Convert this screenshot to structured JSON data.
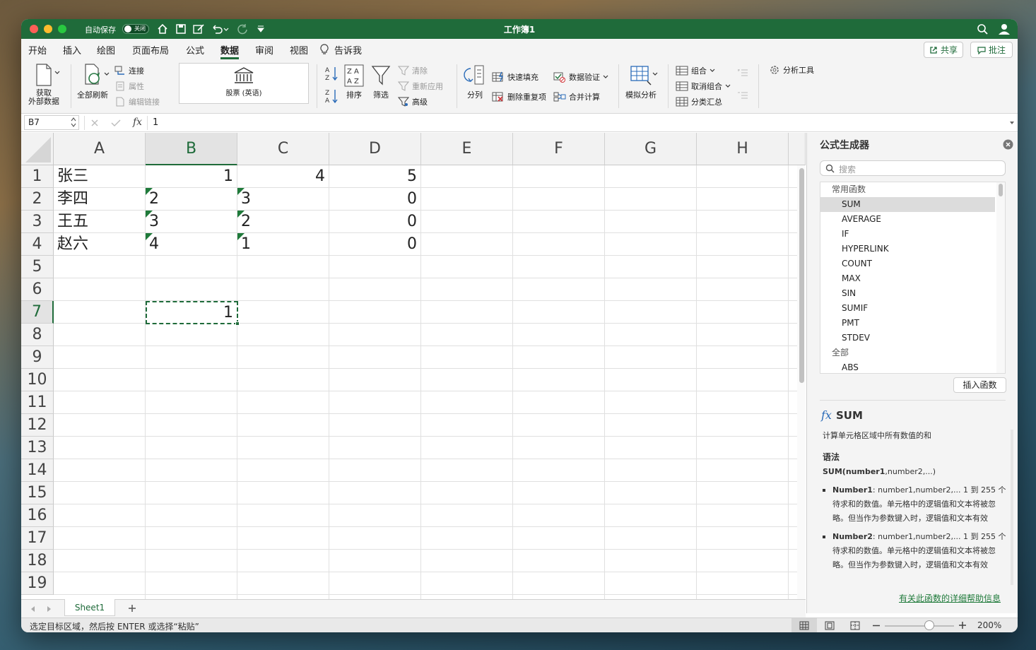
{
  "window": {
    "title": "工作簿1",
    "autosave_label": "自动保存",
    "autosave_state": "关闭"
  },
  "ribbon_tabs": [
    "开始",
    "插入",
    "绘图",
    "页面布局",
    "公式",
    "数据",
    "审阅",
    "视图"
  ],
  "active_tab": "数据",
  "tell_me": "告诉我",
  "share_label": "共享",
  "comments_label": "批注",
  "ribbon": {
    "get_data": [
      "获取",
      "外部数据"
    ],
    "refresh_all": "全部刷新",
    "connections": "连接",
    "properties": "属性",
    "edit_links": "编辑链接",
    "stocks": "股票 (英语)",
    "sort": "排序",
    "filter": "筛选",
    "clear": "清除",
    "reapply": "重新应用",
    "advanced": "高级",
    "text_to_columns": "分列",
    "flash_fill": "快速填充",
    "remove_duplicates": "删除重复项",
    "data_validation": "数据验证",
    "consolidate": "合并计算",
    "what_if": "模拟分析",
    "group": "组合",
    "ungroup": "取消组合",
    "subtotal": "分类汇总",
    "analysis_tools": "分析工具"
  },
  "formula_bar": {
    "name_box": "B7",
    "fx_label": "fx",
    "value": "1"
  },
  "grid": {
    "columns": [
      "A",
      "B",
      "C",
      "D",
      "E",
      "F",
      "G",
      "H"
    ],
    "selected_column": "B",
    "rows": [
      "1",
      "2",
      "3",
      "4",
      "5",
      "6",
      "7",
      "8",
      "9",
      "10",
      "11",
      "12",
      "13",
      "14",
      "15",
      "16",
      "17",
      "18",
      "19"
    ],
    "selected_row": "7",
    "cells": {
      "A1": "张三",
      "B1": "1",
      "C1": "4",
      "D1": "5",
      "A2": "李四",
      "B2": "2",
      "C2": "3",
      "D2": "0",
      "A3": "王五",
      "B3": "3",
      "C3": "2",
      "D3": "0",
      "A4": "赵六",
      "B4": "4",
      "C4": "1",
      "D4": "0",
      "B7": "1"
    }
  },
  "sheet_tabs": [
    "Sheet1"
  ],
  "status": {
    "message": "选定目标区域，然后按 ENTER 或选择“粘贴”",
    "zoom": "200%"
  },
  "panel": {
    "title": "公式生成器",
    "search_placeholder": "搜索",
    "group_common": "常用函数",
    "functions": [
      "SUM",
      "AVERAGE",
      "IF",
      "HYPERLINK",
      "COUNT",
      "MAX",
      "SIN",
      "SUMIF",
      "PMT",
      "STDEV"
    ],
    "group_all": "全部",
    "all_first": "ABS",
    "insert_button": "插入函数",
    "detail_fx": "fx",
    "detail_name": "SUM",
    "detail_desc": "计算单元格区域中所有数值的和",
    "syntax_heading": "语法",
    "syntax_bold": "SUM(number1",
    "syntax_rest": ",number2,...)",
    "arg1_name": "Number1",
    "arg1_text": ": number1,number2,... 1 到 255 个待求和的数值。单元格中的逻辑值和文本将被忽略。但当作为参数键入时，逻辑值和文本有效",
    "arg2_name": "Number2",
    "arg2_text": ": number1,number2,... 1 到 255 个待求和的数值。单元格中的逻辑值和文本将被忽略。但当作为参数键入时，逻辑值和文本有效",
    "help_link": "有关此函数的详细帮助信息"
  }
}
